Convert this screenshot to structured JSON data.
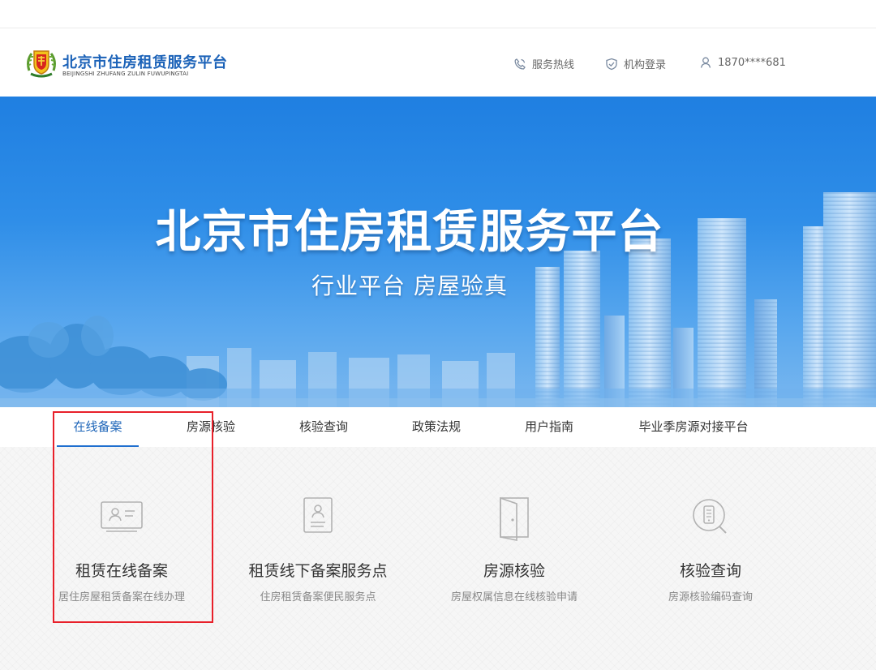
{
  "brand": {
    "title_cn": "北京市住房租赁服务平台",
    "title_en": "BEIJINGSHI ZHUFANG ZULIN FUWUPINGTAI"
  },
  "header": {
    "hotline": "服务热线",
    "org_login": "机构登录",
    "user_phone": "1870****681"
  },
  "hero": {
    "title": "北京市住房租赁服务平台",
    "subtitle": "行业平台 房屋验真"
  },
  "nav": {
    "tabs": [
      "在线备案",
      "房源核验",
      "核验查询",
      "政策法规",
      "用户指南",
      "毕业季房源对接平台"
    ],
    "active_index": 0
  },
  "services": [
    {
      "title": "租赁在线备案",
      "desc": "居住房屋租赁备案在线办理",
      "icon": "id-card-icon"
    },
    {
      "title": "租赁线下备案服务点",
      "desc": "住房租赁备案便民服务点",
      "icon": "document-user-icon"
    },
    {
      "title": "房源核验",
      "desc": "房屋权属信息在线核验申请",
      "icon": "door-icon"
    },
    {
      "title": "核验查询",
      "desc": "房源核验编码查询",
      "icon": "search-phone-icon"
    }
  ],
  "colors": {
    "brand_blue": "#1b62b8",
    "hero_blue": "#2f8ee8",
    "highlight_red": "#e8202a"
  }
}
